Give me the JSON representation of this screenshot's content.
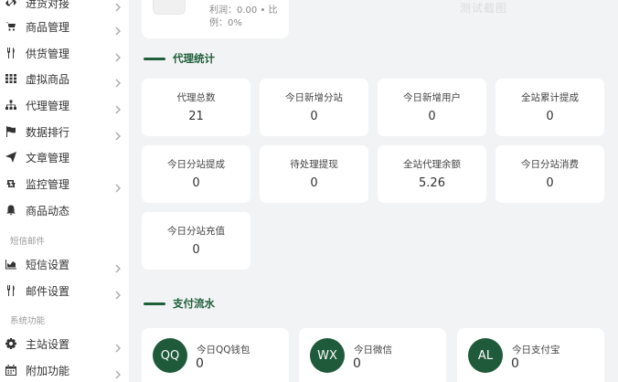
{
  "sidebar": {
    "items": [
      {
        "label": "进货对接",
        "icon": "link-icon",
        "chevron": true
      },
      {
        "label": "商品管理",
        "icon": "cart-icon",
        "chevron": true
      },
      {
        "label": "供货管理",
        "icon": "cutlery-icon",
        "chevron": true
      },
      {
        "label": "虚拟商品",
        "icon": "grid-icon",
        "chevron": true
      },
      {
        "label": "代理管理",
        "icon": "sitemap-icon",
        "chevron": true
      },
      {
        "label": "数据排行",
        "icon": "flag-icon",
        "chevron": true
      },
      {
        "label": "文章管理",
        "icon": "send-icon",
        "chevron": false
      },
      {
        "label": "监控管理",
        "icon": "retweet-icon",
        "chevron": true
      },
      {
        "label": "商品动态",
        "icon": "bell-icon",
        "chevron": false
      },
      {
        "label": "短信设置",
        "icon": "chart-icon",
        "chevron": true
      },
      {
        "label": "邮件设置",
        "icon": "cutlery-icon",
        "chevron": true
      },
      {
        "label": "主站设置",
        "icon": "gear-icon",
        "chevron": true
      },
      {
        "label": "附加功能",
        "icon": "calendar-icon",
        "chevron": true
      }
    ],
    "sections": {
      "sms_mail": "短信邮件",
      "system": "系统功能"
    }
  },
  "top_card": {
    "line1": "利润：0.00 • 比",
    "line2": "例：0%"
  },
  "watermark": "测试截图",
  "agent_stats": {
    "title": "代理统计",
    "cards": [
      {
        "label": "代理总数",
        "value": "21"
      },
      {
        "label": "今日新增分站",
        "value": "0"
      },
      {
        "label": "今日新增用户",
        "value": "0"
      },
      {
        "label": "全站累计提成",
        "value": "0"
      },
      {
        "label": "今日分站提成",
        "value": "0"
      },
      {
        "label": "待处理提现",
        "value": "0"
      },
      {
        "label": "全站代理余额",
        "value": "5.26"
      },
      {
        "label": "今日分站消费",
        "value": "0"
      },
      {
        "label": "今日分站充值",
        "value": "0"
      }
    ]
  },
  "payment_flow": {
    "title": "支付流水",
    "cards": [
      {
        "badge": "QQ",
        "label": "今日QQ钱包",
        "value": "0"
      },
      {
        "badge": "WX",
        "label": "今日微信",
        "value": "0"
      },
      {
        "badge": "AL",
        "label": "今日支付宝",
        "value": "0"
      }
    ]
  }
}
